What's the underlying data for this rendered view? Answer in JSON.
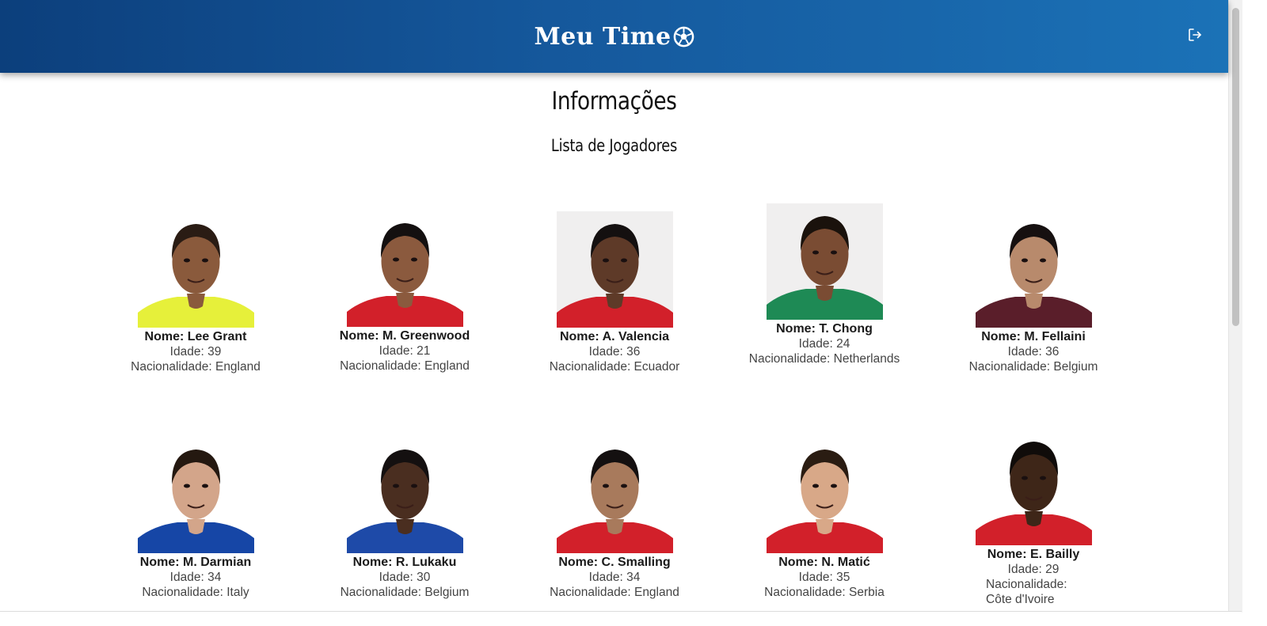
{
  "header": {
    "brand_name": "Meu Time",
    "brand_icon": "soccer-ball-icon",
    "logout_icon": "logout-icon"
  },
  "main": {
    "title": "Informações",
    "subtitle": "Lista de Jogadores"
  },
  "players": [
    {
      "name": "Nome: Lee Grant",
      "age": "Idade: 39",
      "nationality": "Nacionalidade: England",
      "jersey": "#e6f03a",
      "skin": "#8a5a3c",
      "hair": "#2a1c14"
    },
    {
      "name": "Nome: M. Greenwood",
      "age": "Idade: 21",
      "nationality": "Nacionalidade: England",
      "jersey": "#d2202a",
      "skin": "#8b5a3e",
      "hair": "#141010"
    },
    {
      "name": "Nome: A. Valencia",
      "age": "Idade: 36",
      "nationality": "Nacionalidade: Ecuador",
      "jersey": "#d2202a",
      "skin": "#5e3a28",
      "hair": "#141010"
    },
    {
      "name": "Nome: T. Chong",
      "age": "Idade: 24",
      "nationality": "Nacionalidade: Netherlands",
      "jersey": "#1e8a55",
      "skin": "#7a4c33",
      "hair": "#1a120c"
    },
    {
      "name": "Nome: M. Fellaini",
      "age": "Idade: 36",
      "nationality": "Nacionalidade: Belgium",
      "jersey": "#5a1e2a",
      "skin": "#b88a6c",
      "hair": "#161010"
    },
    {
      "name": "Nome: M. Darmian",
      "age": "Idade: 34",
      "nationality": "Nacionalidade: Italy",
      "jersey": "#1646a6",
      "skin": "#d3a58a",
      "hair": "#241810"
    },
    {
      "name": "Nome: R. Lukaku",
      "age": "Idade: 30",
      "nationality": "Nacionalidade: Belgium",
      "jersey": "#1e4aa8",
      "skin": "#4a2e20",
      "hair": "#141010"
    },
    {
      "name": "Nome: C. Smalling",
      "age": "Idade: 34",
      "nationality": "Nacionalidade: England",
      "jersey": "#d2202a",
      "skin": "#a87a5c",
      "hair": "#141010"
    },
    {
      "name": "Nome: N. Matić",
      "age": "Idade: 35",
      "nationality": "Nacionalidade: Serbia",
      "jersey": "#d2202a",
      "skin": "#d8a888",
      "hair": "#2a1c12"
    },
    {
      "name": "Nome: E. Bailly",
      "age": "Idade: 29",
      "nationality": "Nacionalidade: Côte d'Ivoire",
      "jersey": "#d2202a",
      "skin": "#3e2618",
      "hair": "#100c0a"
    }
  ],
  "colors": {
    "header_start": "#0c3f7c",
    "header_end": "#1b72b7"
  }
}
